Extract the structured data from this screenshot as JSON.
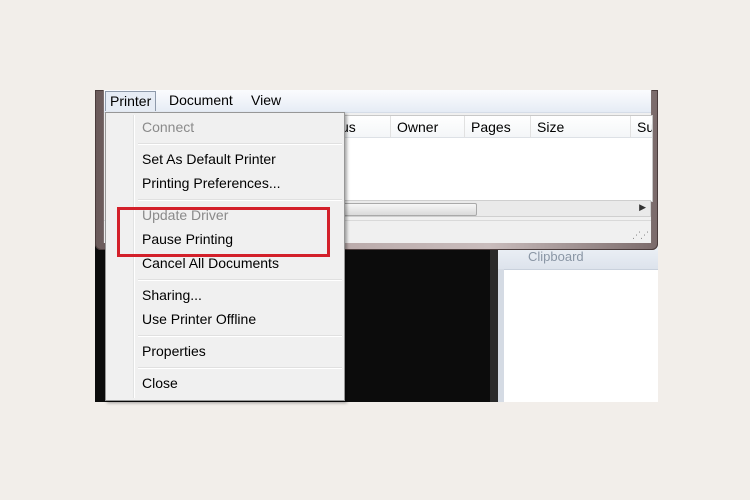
{
  "menubar": {
    "items": [
      "Printer",
      "Document",
      "View"
    ]
  },
  "columns": [
    "us",
    "Owner",
    "Pages",
    "Size",
    "Su"
  ],
  "ribbon": {
    "label": "Clipboard"
  },
  "printer_menu": {
    "items": [
      {
        "label": "Connect",
        "enabled": false
      },
      {
        "label": "Set As Default Printer",
        "enabled": true
      },
      {
        "label": "Printing Preferences...",
        "enabled": true
      },
      {
        "label": "Update Driver",
        "enabled": false
      },
      {
        "label": "Pause Printing",
        "enabled": true
      },
      {
        "label": "Cancel All Documents",
        "enabled": true
      },
      {
        "label": "Sharing...",
        "enabled": true
      },
      {
        "label": "Use Printer Offline",
        "enabled": true
      },
      {
        "label": "Properties",
        "enabled": true
      },
      {
        "label": "Close",
        "enabled": true
      }
    ]
  },
  "colors": {
    "highlight": "#d3202a",
    "disabled_text": "#8a8a8a"
  },
  "icons": {
    "scroll_right": "triangle-right-icon",
    "resize": "resize-grip-icon"
  }
}
